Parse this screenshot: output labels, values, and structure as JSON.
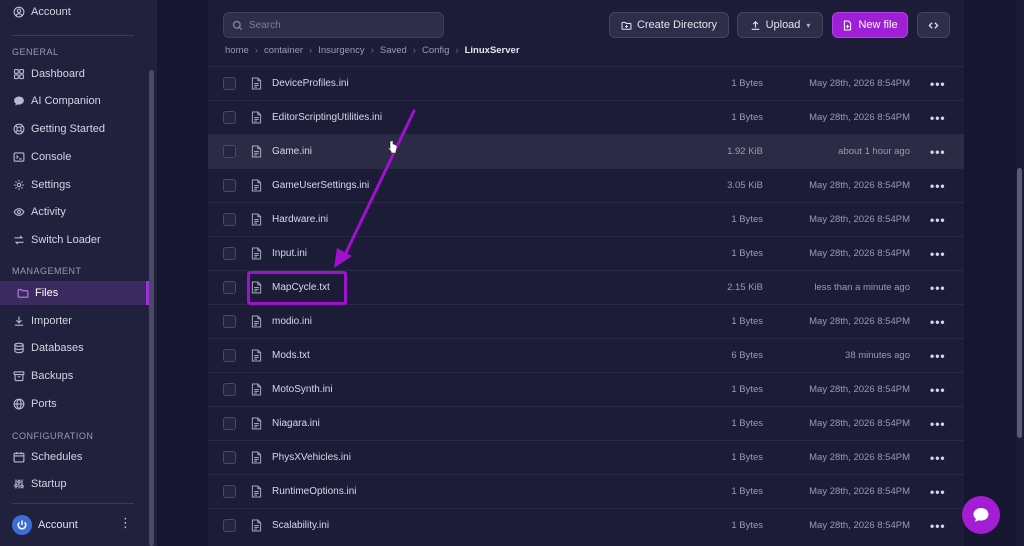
{
  "sidebar": {
    "top_account": "Account",
    "sections": {
      "general": "GENERAL",
      "management": "MANAGEMENT",
      "configuration": "CONFIGURATION"
    },
    "items": [
      {
        "label": "Dashboard",
        "icon": "grid-icon"
      },
      {
        "label": "AI Companion",
        "icon": "chat-bubble-icon"
      },
      {
        "label": "Getting Started",
        "icon": "lifebuoy-icon"
      },
      {
        "label": "Console",
        "icon": "terminal-icon"
      },
      {
        "label": "Settings",
        "icon": "gear-icon"
      },
      {
        "label": "Activity",
        "icon": "eye-icon"
      },
      {
        "label": "Switch Loader",
        "icon": "switch-arrows-icon"
      },
      {
        "label": "Files",
        "icon": "folder-icon",
        "active": true
      },
      {
        "label": "Importer",
        "icon": "download-icon"
      },
      {
        "label": "Databases",
        "icon": "database-icon"
      },
      {
        "label": "Backups",
        "icon": "archive-icon"
      },
      {
        "label": "Ports",
        "icon": "globe-icon"
      },
      {
        "label": "Schedules",
        "icon": "calendar-icon"
      },
      {
        "label": "Startup",
        "icon": "sliders-icon"
      }
    ],
    "bottom_account": "Account"
  },
  "toolbar": {
    "search_placeholder": "Search",
    "create_directory": "Create Directory",
    "upload": "Upload",
    "new_file": "New file"
  },
  "breadcrumb": [
    "home",
    "container",
    "Insurgency",
    "Saved",
    "Config",
    "LinuxServer"
  ],
  "files": [
    {
      "name": "DeviceProfiles.ini",
      "size": "1 Bytes",
      "modified": "May 28th, 2026 8:54PM"
    },
    {
      "name": "EditorScriptingUtilities.ini",
      "size": "1 Bytes",
      "modified": "May 28th, 2026 8:54PM"
    },
    {
      "name": "Game.ini",
      "size": "1.92 KiB",
      "modified": "about 1 hour ago"
    },
    {
      "name": "GameUserSettings.ini",
      "size": "3.05 KiB",
      "modified": "May 28th, 2026 8:54PM"
    },
    {
      "name": "Hardware.ini",
      "size": "1 Bytes",
      "modified": "May 28th, 2026 8:54PM"
    },
    {
      "name": "Input.ini",
      "size": "1 Bytes",
      "modified": "May 28th, 2026 8:54PM"
    },
    {
      "name": "MapCycle.txt",
      "size": "2.15 KiB",
      "modified": "less than a minute ago"
    },
    {
      "name": "modio.ini",
      "size": "1 Bytes",
      "modified": "May 28th, 2026 8:54PM"
    },
    {
      "name": "Mods.txt",
      "size": "6 Bytes",
      "modified": "38 minutes ago"
    },
    {
      "name": "MotoSynth.ini",
      "size": "1 Bytes",
      "modified": "May 28th, 2026 8:54PM"
    },
    {
      "name": "Niagara.ini",
      "size": "1 Bytes",
      "modified": "May 28th, 2026 8:54PM"
    },
    {
      "name": "PhysXVehicles.ini",
      "size": "1 Bytes",
      "modified": "May 28th, 2026 8:54PM"
    },
    {
      "name": "RuntimeOptions.ini",
      "size": "1 Bytes",
      "modified": "May 28th, 2026 8:54PM"
    },
    {
      "name": "Scalability.ini",
      "size": "1 Bytes",
      "modified": "May 28th, 2026 8:54PM"
    }
  ],
  "colors": {
    "accent": "#9e1fd6",
    "annotation": "#9f10cf",
    "background": "#191933"
  }
}
